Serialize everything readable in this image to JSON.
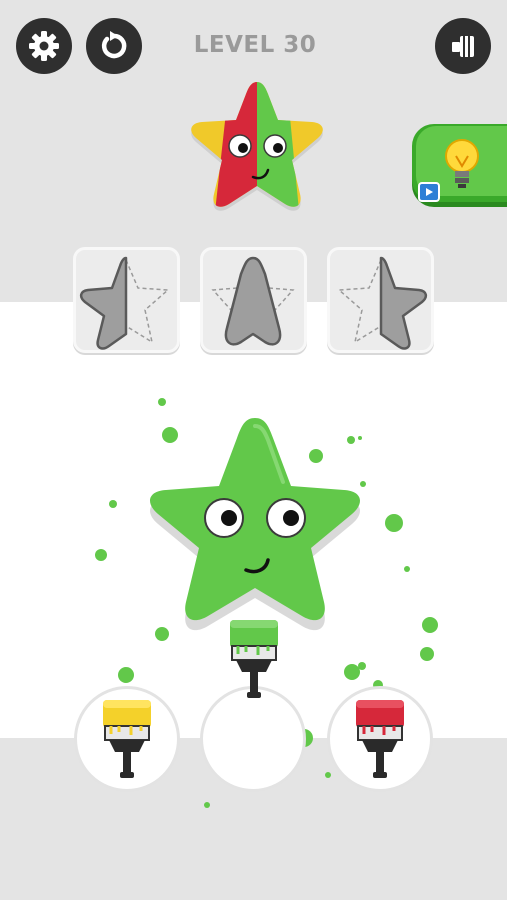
{
  "header": {
    "level_text": "LEVEL 30",
    "settings_icon": "gear-icon",
    "restart_icon": "restart-icon",
    "eraser_icon": "eraser-icon"
  },
  "target": {
    "colors": [
      "#e8c62a",
      "#d6283a",
      "#62c84a"
    ],
    "shape": "star"
  },
  "hint": {
    "icon": "lightbulb-icon",
    "badge": "video-icon"
  },
  "stencil_options": [
    {
      "name": "left-half-star"
    },
    {
      "name": "center-star"
    },
    {
      "name": "right-half-star"
    }
  ],
  "canvas": {
    "shape": "star",
    "current_color": "#62c84a"
  },
  "brushes": [
    {
      "name": "yellow-brush",
      "color": "#f4d12a",
      "state": "available"
    },
    {
      "name": "green-brush",
      "color": "#62c84a",
      "state": "in-use"
    },
    {
      "name": "red-brush",
      "color": "#d6283a",
      "state": "available"
    }
  ],
  "colors": {
    "green": "#62c84a",
    "yellow": "#f4d12a",
    "red": "#d6283a",
    "dark": "#2f2f2f"
  }
}
